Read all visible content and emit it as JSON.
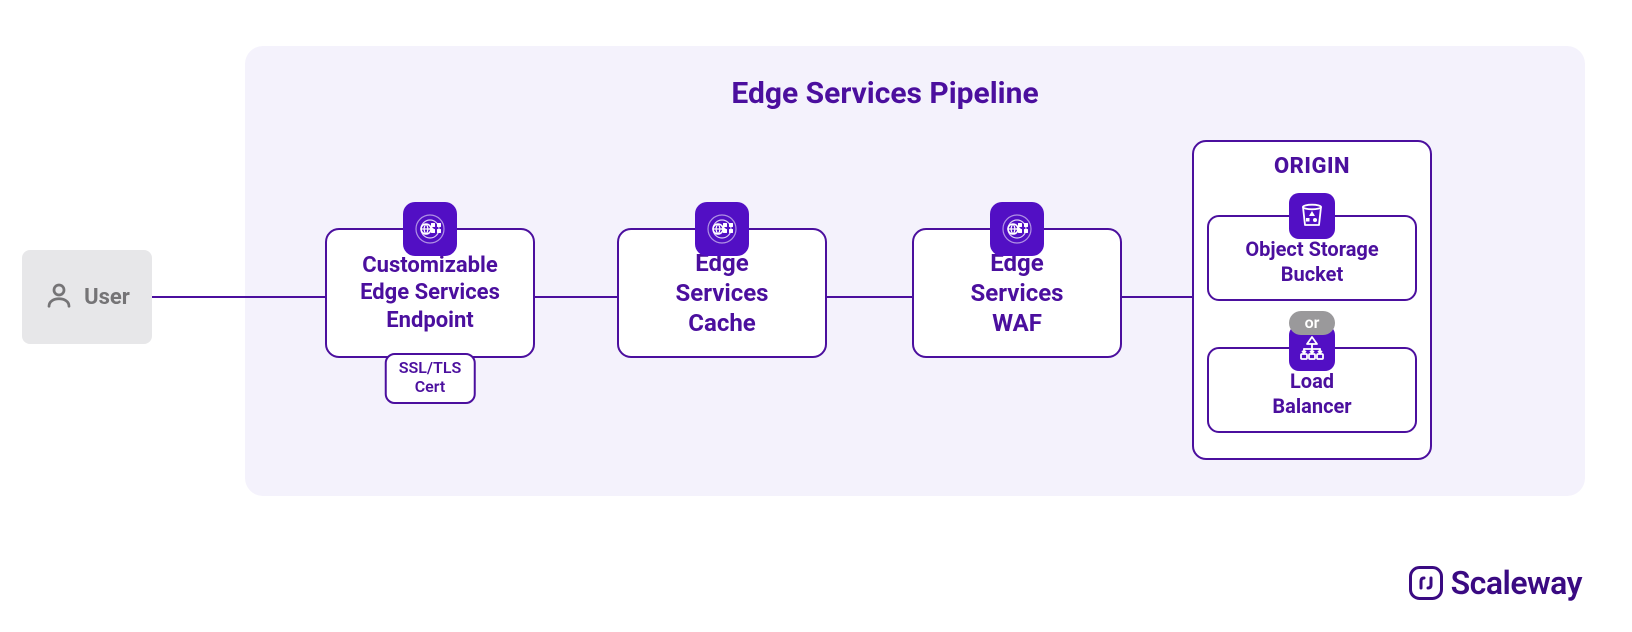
{
  "user": {
    "label": "User"
  },
  "panel": {
    "title": "Edge Services Pipeline"
  },
  "stages": {
    "endpoint": {
      "line1": "Customizable",
      "line2": "Edge Services",
      "line3": "Endpoint"
    },
    "cache": {
      "line1": "Edge",
      "line2": "Services",
      "line3": "Cache"
    },
    "waf": {
      "line1": "Edge",
      "line2": "Services",
      "line3": "WAF"
    },
    "ssl": {
      "line1": "SSL/TLS",
      "line2": "Cert"
    }
  },
  "origin": {
    "title": "ORIGIN",
    "object_storage": {
      "line1": "Object Storage",
      "line2": "Bucket"
    },
    "or": "or",
    "load_balancer": {
      "line1": "Load",
      "line2": "Balancer"
    }
  },
  "brand": {
    "name": "Scaleway"
  }
}
